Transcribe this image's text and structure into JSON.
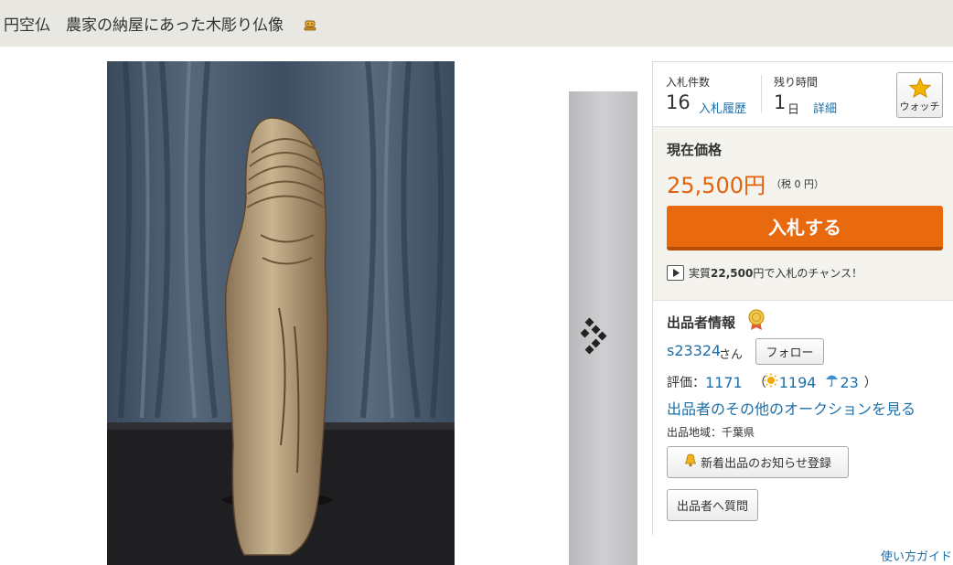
{
  "title": {
    "text": "円空仏　農家の納屋にあった木彫り仏像"
  },
  "stats": {
    "bid_count_label": "入札件数",
    "bid_count": "16",
    "bid_history_link": "入札履歴",
    "time_left_label": "残り時間",
    "time_left": "1",
    "time_left_unit": "日",
    "detail_link": "詳細",
    "watch_label": "ウォッチ"
  },
  "price": {
    "label": "現在価格",
    "value": "25,500円",
    "tax": "（税 0 円）",
    "bid_button": "入札する",
    "chance_prefix": "実質",
    "chance_amount": "22,500",
    "chance_suffix": "円で入札のチャンス！"
  },
  "seller": {
    "section_title": "出品者情報",
    "name": "s23324",
    "name_suffix": "さん",
    "follow_button": "フォロー",
    "rating_label": "評価：",
    "rating_value": "1171",
    "open_paren": "（",
    "good_count": "1194",
    "bad_count": "23",
    "close_paren": "）",
    "other_auctions_link": "出品者のその他のオークションを見る",
    "region": "出品地域：千葉県",
    "notify_button": "新着出品のお知らせ登録",
    "question_button": "出品者へ質問"
  },
  "footer": {
    "help_link": "使い方ガイド"
  },
  "colors": {
    "accent_orange": "#e8690e",
    "price_orange": "#e4620c",
    "link_blue": "#1d6fa8",
    "title_bar_bg": "#e8e7e2"
  },
  "icons": {
    "title_icon": "auction-gavel-icon",
    "watch_icon": "star-icon",
    "next_icon": "next-arrow-icon",
    "medal_icon": "medal-icon",
    "sun_icon": "sun-icon",
    "umbrella_icon": "umbrella-icon",
    "bell_icon": "bell-icon",
    "play_icon": "play-icon"
  }
}
